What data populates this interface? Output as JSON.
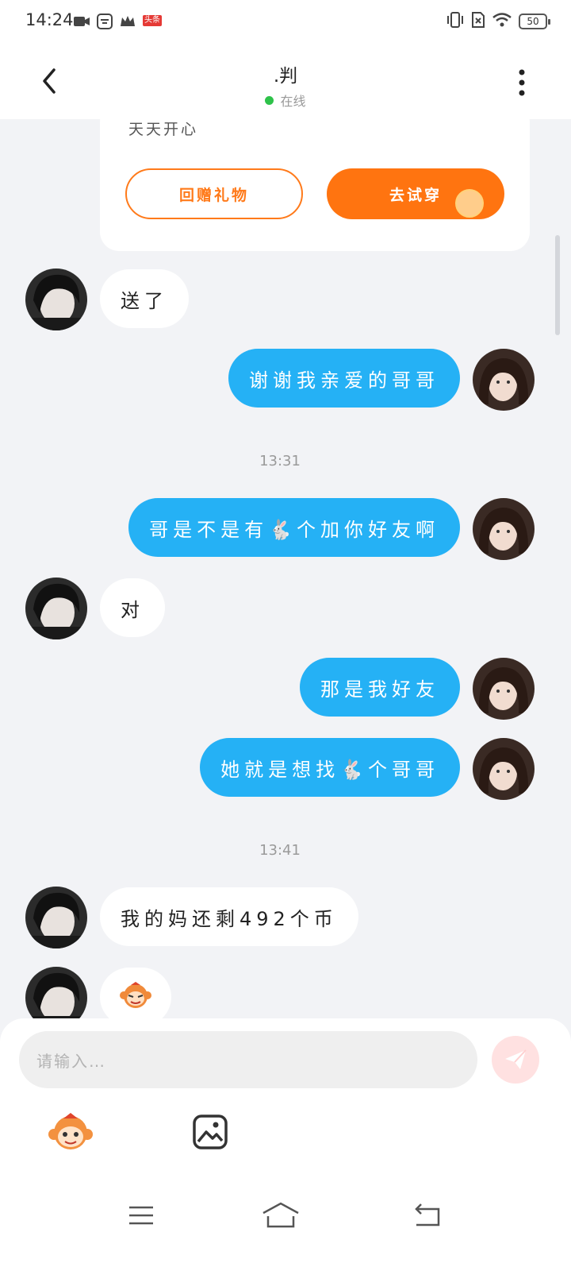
{
  "status_bar": {
    "time": "14:24",
    "battery": "50",
    "badge": "头条"
  },
  "header": {
    "title": ".判",
    "status": "在线"
  },
  "gift_card": {
    "text": "天天开心",
    "return_gift_label": "回赠礼物",
    "try_on_label": "去试穿"
  },
  "messages": [
    {
      "side": "in",
      "text": "送了"
    },
    {
      "side": "out",
      "text": "谢谢我亲爱的哥哥"
    },
    {
      "type": "time",
      "text": "13:31"
    },
    {
      "side": "out",
      "text": "哥是不是有🐇个加你好友啊"
    },
    {
      "side": "in",
      "text": "对"
    },
    {
      "side": "out",
      "text": "那是我好友"
    },
    {
      "side": "out",
      "text": "她就是想找🐇个哥哥"
    },
    {
      "type": "time",
      "text": "13:41"
    },
    {
      "side": "in",
      "text": "我的妈还剩492个币"
    },
    {
      "side": "in",
      "type": "sticker",
      "icon": "monkey-sticker"
    }
  ],
  "composer": {
    "placeholder": "请输入…",
    "emoji_icon": "monkey-emoji-icon",
    "image_icon": "image-icon",
    "send_icon": "paper-plane-icon"
  },
  "colors": {
    "accent_orange": "#ff7410",
    "outgoing_bubble": "#25b1f5",
    "online_green": "#2ec24a"
  }
}
